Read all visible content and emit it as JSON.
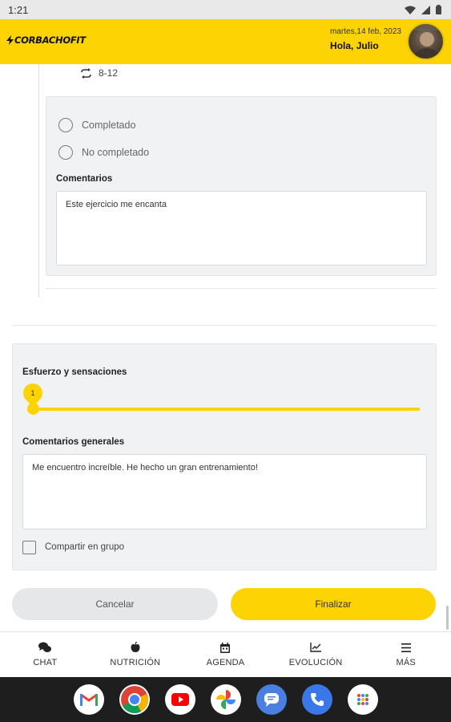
{
  "status_bar": {
    "time": "1:21"
  },
  "header": {
    "brand": "CORBACHOFIT",
    "date": "martes,14 feb, 2023",
    "greeting": "Hola, Julio"
  },
  "exercise": {
    "reps": "8-12",
    "options": [
      "Completado",
      "No completado"
    ],
    "comments_label": "Comentarios",
    "comments_value": "Este ejercicio me encanta"
  },
  "effort": {
    "label": "Esfuerzo y sensaciones",
    "slider_value": "1",
    "general_comments_label": "Comentarios generales",
    "general_comments_value": "Me encuentro increíble. He hecho un gran entrenamiento!",
    "share_label": "Compartir en grupo"
  },
  "actions": {
    "cancel": "Cancelar",
    "finish": "Finalizar"
  },
  "bottom_nav": [
    {
      "label": "CHAT",
      "icon": "chat-icon"
    },
    {
      "label": "NUTRICIÓN",
      "icon": "apple-icon"
    },
    {
      "label": "AGENDA",
      "icon": "calendar-icon"
    },
    {
      "label": "EVOLUCIÓN",
      "icon": "chart-icon"
    },
    {
      "label": "MÁS",
      "icon": "menu-icon"
    }
  ],
  "dock_apps": [
    "gmail-icon",
    "chrome-icon",
    "youtube-icon",
    "photos-icon",
    "messages-icon",
    "phone-icon",
    "app-drawer-icon"
  ],
  "colors": {
    "accent": "#fdd304",
    "card_bg": "#f1f2f3",
    "system_bar": "#1e1e1e"
  }
}
